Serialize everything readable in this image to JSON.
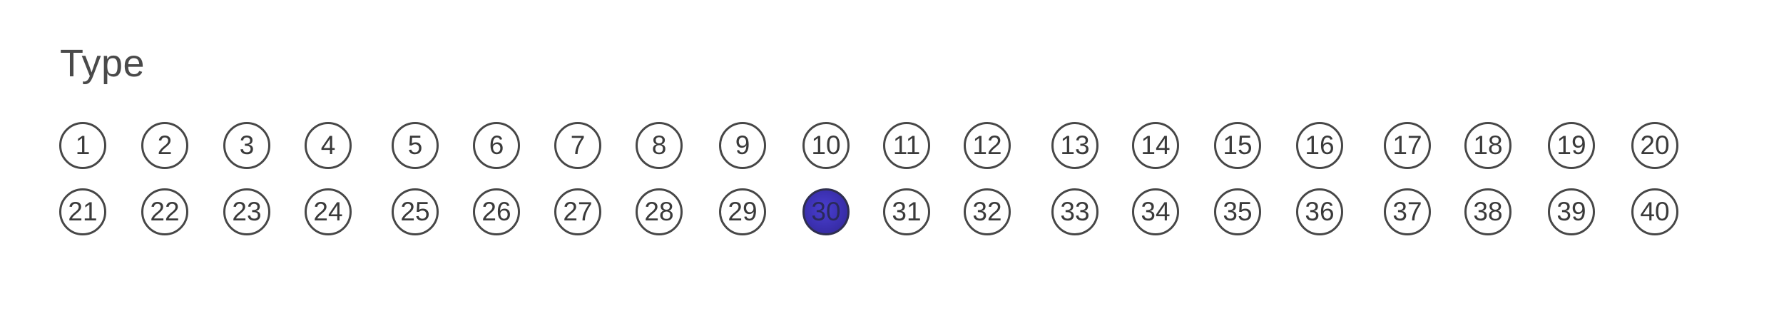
{
  "title": "Type",
  "rows": [
    [
      "1",
      "2",
      "3",
      "4",
      "5",
      "6",
      "7",
      "8",
      "9",
      "10",
      "11",
      "12",
      "13",
      "14",
      "15",
      "16",
      "17",
      "18",
      "19",
      "20"
    ],
    [
      "21",
      "22",
      "23",
      "24",
      "25",
      "26",
      "27",
      "28",
      "29",
      "30",
      "31",
      "32",
      "33",
      "34",
      "35",
      "36",
      "37",
      "38",
      "39",
      "40"
    ]
  ],
  "selected": [
    "30"
  ],
  "colors": {
    "ink": "#474747",
    "fill": "#3b30b0"
  }
}
